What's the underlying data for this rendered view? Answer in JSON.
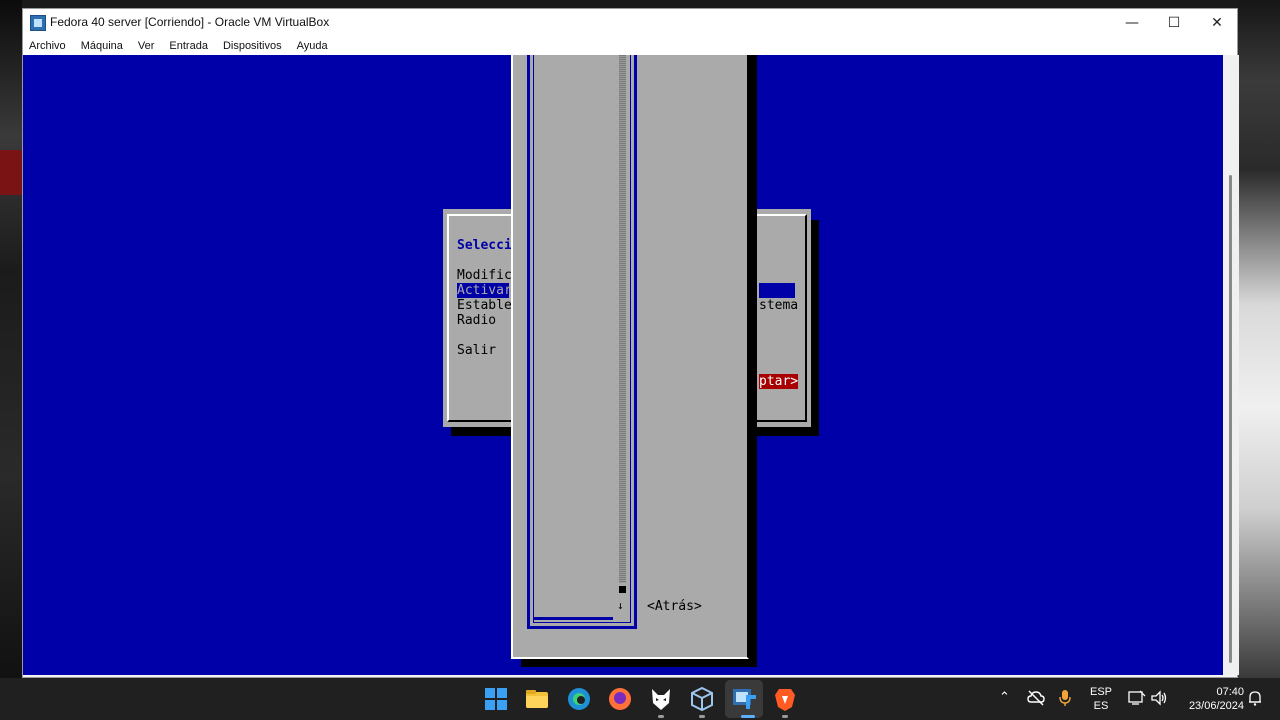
{
  "window": {
    "title": "Fedora 40 server [Corriendo] - Oracle VM VirtualBox",
    "controls": {
      "minimize": "—",
      "maximize": "☐",
      "close": "✕"
    }
  },
  "menubar": {
    "items": [
      "Archivo",
      "Máquina",
      "Ver",
      "Entrada",
      "Dispositivos",
      "Ayuda"
    ]
  },
  "tui": {
    "back_dialog": {
      "title": "Selecci",
      "items": [
        "Modific",
        "Activar",
        "Estable",
        "Radio",
        "Salir"
      ],
      "item_right_fragment": "stema",
      "accept_fragment": "ptar>"
    },
    "front_dialog": {
      "scroll_down_arrow": "↓",
      "back_button": "<Atrás>"
    }
  },
  "taskbar": {
    "icons": [
      "windows-start-icon",
      "file-explorer-icon",
      "edge-icon",
      "firefox-icon",
      "fox-app-icon",
      "virtualbox-icon",
      "vm-session-icon",
      "brave-icon"
    ],
    "tray": {
      "language_top": "ESP",
      "language_bottom": "ES",
      "time": "07:40",
      "date": "23/06/2024"
    }
  },
  "colors": {
    "vm_background": "#0000a8",
    "dialog_gray": "#aaaaaa",
    "highlight_blue": "#0000a8",
    "accept_red": "#a80000",
    "taskbar": "#202020"
  }
}
